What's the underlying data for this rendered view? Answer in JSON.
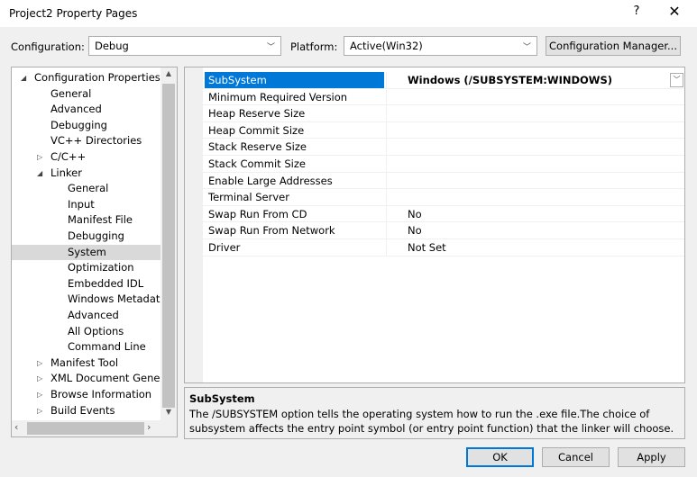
{
  "window": {
    "title": "Project2 Property Pages",
    "help": "?",
    "close": "✕"
  },
  "config_bar": {
    "configuration_label": "Configuration:",
    "configuration_value": "Debug",
    "platform_label": "Platform:",
    "platform_value": "Active(Win32)",
    "manager_button": "Configuration Manager..."
  },
  "tree": {
    "items": [
      {
        "label": "Configuration Properties",
        "expander": "◢"
      },
      {
        "label": "General"
      },
      {
        "label": "Advanced"
      },
      {
        "label": "Debugging"
      },
      {
        "label": "VC++ Directories"
      },
      {
        "label": "C/C++",
        "expander": "▷"
      },
      {
        "label": "Linker",
        "expander": "◢"
      },
      {
        "label": "General"
      },
      {
        "label": "Input"
      },
      {
        "label": "Manifest File"
      },
      {
        "label": "Debugging"
      },
      {
        "label": "System"
      },
      {
        "label": "Optimization"
      },
      {
        "label": "Embedded IDL"
      },
      {
        "label": "Windows Metadata"
      },
      {
        "label": "Advanced"
      },
      {
        "label": "All Options"
      },
      {
        "label": "Command Line"
      },
      {
        "label": "Manifest Tool",
        "expander": "▷"
      },
      {
        "label": "XML Document Genera",
        "expander": "▷"
      },
      {
        "label": "Browse Information",
        "expander": "▷"
      },
      {
        "label": "Build Events",
        "expander": "▷"
      }
    ]
  },
  "properties": [
    {
      "name": "SubSystem",
      "value": "Windows (/SUBSYSTEM:WINDOWS)"
    },
    {
      "name": "Minimum Required Version",
      "value": ""
    },
    {
      "name": "Heap Reserve Size",
      "value": ""
    },
    {
      "name": "Heap Commit Size",
      "value": ""
    },
    {
      "name": "Stack Reserve Size",
      "value": ""
    },
    {
      "name": "Stack Commit Size",
      "value": ""
    },
    {
      "name": "Enable Large Addresses",
      "value": ""
    },
    {
      "name": "Terminal Server",
      "value": ""
    },
    {
      "name": "Swap Run From CD",
      "value": "No"
    },
    {
      "name": "Swap Run From Network",
      "value": "No"
    },
    {
      "name": "Driver",
      "value": "Not Set"
    }
  ],
  "description": {
    "title": "SubSystem",
    "text": "The /SUBSYSTEM option tells the operating system how to run the .exe file.The choice of subsystem affects the entry point symbol (or entry point function) that the linker will choose."
  },
  "buttons": {
    "ok": "OK",
    "cancel": "Cancel",
    "apply": "Apply"
  }
}
